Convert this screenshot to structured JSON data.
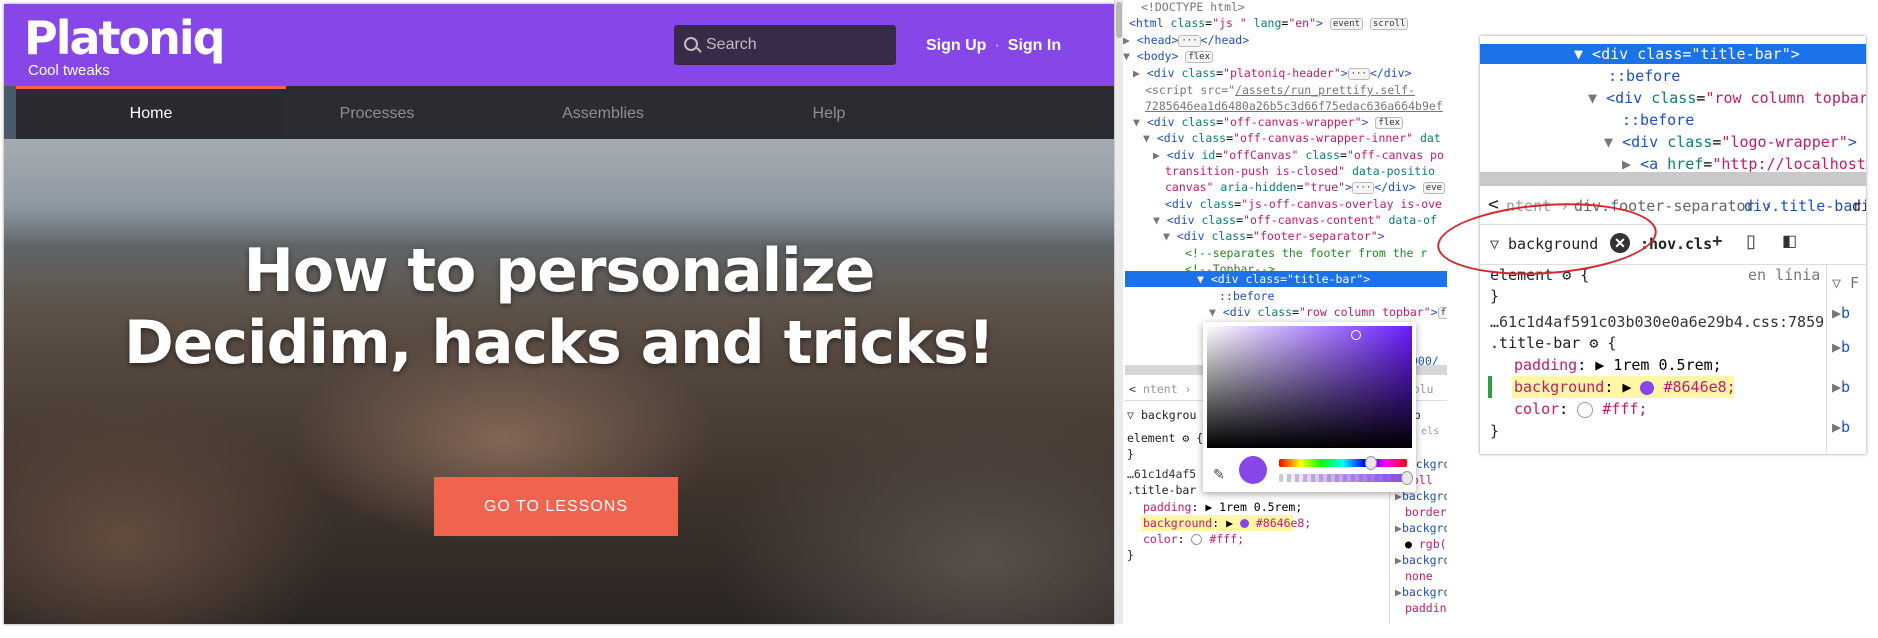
{
  "site": {
    "logo": "Platoniq",
    "tagline": "Cool tweaks",
    "search_placeholder": "Search",
    "signup": "Sign Up",
    "separator": "·",
    "signin": "Sign In",
    "nav": [
      "Home",
      "Processes",
      "Assemblies",
      "Help"
    ],
    "hero_line1": "How to personalize",
    "hero_line2": "Decidim, hacks and tricks!",
    "cta": "GO TO LESSONS"
  },
  "devtools": {
    "doctype": "<!DOCTYPE html>",
    "badge_event": "event",
    "badge_scroll": "scroll",
    "badge_flex": "flex",
    "badge_dots": "···",
    "filter_value": "backgrou",
    "element_label": "element",
    "selector": ".title-bar",
    "file_ref": "…61c1d4af5",
    "padding_value": "1rem 0.5rem;",
    "background_value": "#8646e8;",
    "color_value": "#fff;",
    "right_props": [
      "backgro",
      "roll",
      "backgro",
      "border-",
      "backgro",
      "rgb(2",
      "backgro",
      "none",
      "backgro",
      "padding",
      "backgro"
    ],
    "display_tab": "Disp",
    "extra": "tra els"
  },
  "zoom": {
    "crumb1": "ntent",
    "crumb2": "div.footer-separator",
    "crumb3": "div.title-bar",
    "crumb4": "div",
    "filter_value": "background",
    "hov": ":hov",
    "cls": ".cls",
    "element_label": "element",
    "inline_label": "en línia",
    "file_ref": "…61c1d4af591c03b030e0a6e29b4.css:7859",
    "selector": ".title-bar",
    "padding_value": "1rem 0.5rem;",
    "background_value": "#8646e8;",
    "color_value": "#fff;"
  },
  "colors": {
    "brand": "#8646e8",
    "accent": "#f0634f",
    "selection": "#1a73e8"
  }
}
